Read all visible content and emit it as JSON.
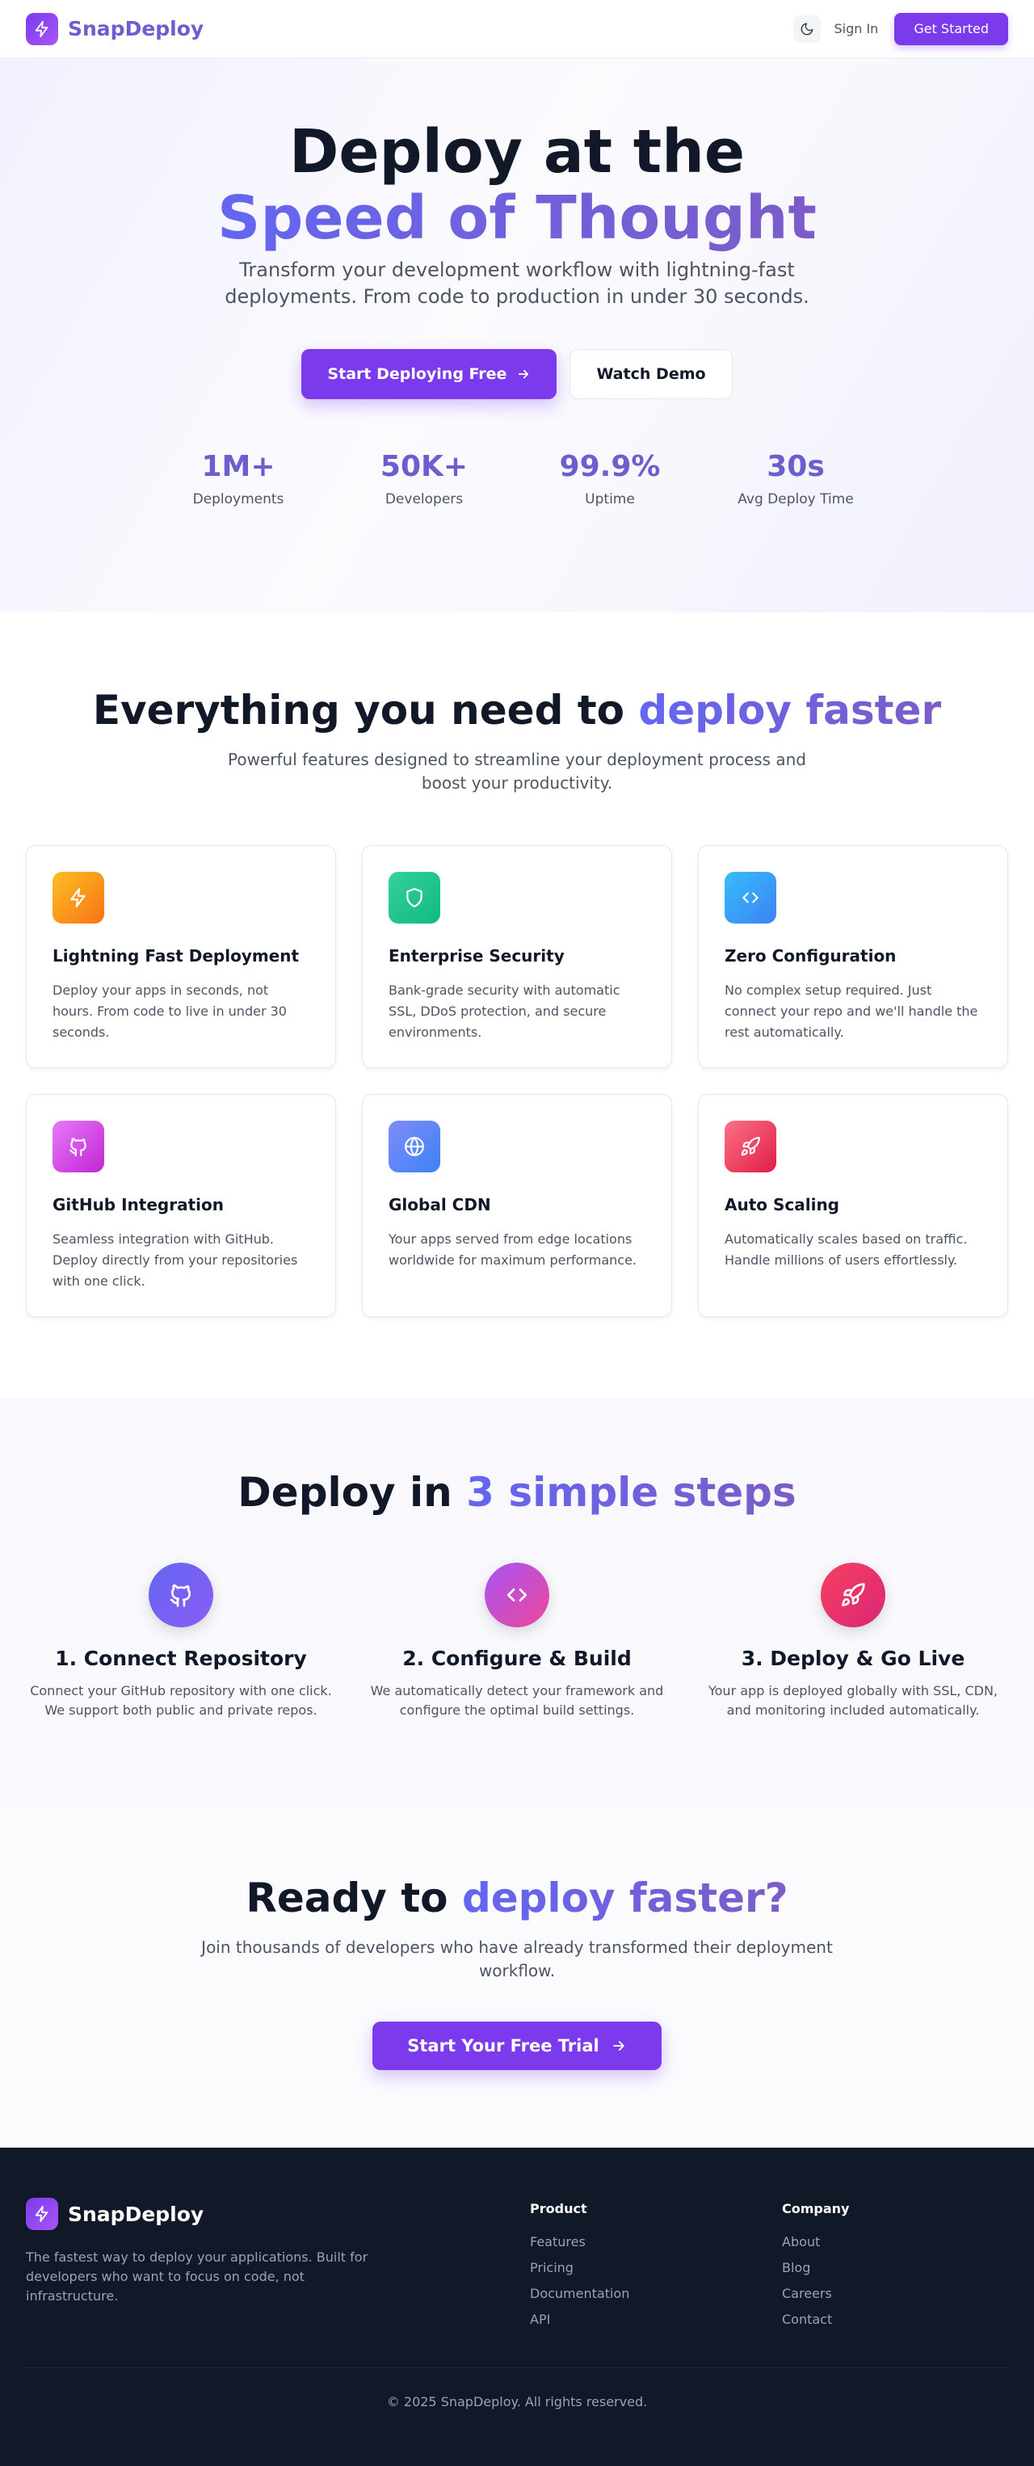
{
  "nav": {
    "brand": "SnapDeploy",
    "sign_in": "Sign In",
    "get_started": "Get Started"
  },
  "hero": {
    "title_line1": "Deploy at the",
    "title_line2": "Speed of Thought",
    "subtitle": "Transform your development workflow with lightning-fast deployments. From code to production in under 30 seconds.",
    "primary_cta": "Start Deploying Free",
    "secondary_cta": "Watch Demo",
    "stats": [
      {
        "value": "1M+",
        "label": "Deployments"
      },
      {
        "value": "50K+",
        "label": "Developers"
      },
      {
        "value": "99.9%",
        "label": "Uptime"
      },
      {
        "value": "30s",
        "label": "Avg Deploy Time"
      }
    ]
  },
  "features": {
    "title_plain": "Everything you need to ",
    "title_accent": "deploy faster",
    "subtitle": "Powerful features designed to streamline your deployment process and boost your productivity.",
    "cards": [
      {
        "icon": "lightning-icon",
        "title": "Lightning Fast Deployment",
        "desc": "Deploy your apps in seconds, not hours. From code to live in under 30 seconds."
      },
      {
        "icon": "shield-icon",
        "title": "Enterprise Security",
        "desc": "Bank-grade security with automatic SSL, DDoS protection, and secure environments."
      },
      {
        "icon": "code-icon",
        "title": "Zero Configuration",
        "desc": "No complex setup required. Just connect your repo and we'll handle the rest automatically."
      },
      {
        "icon": "github-icon",
        "title": "GitHub Integration",
        "desc": "Seamless integration with GitHub. Deploy directly from your repositories with one click."
      },
      {
        "icon": "globe-icon",
        "title": "Global CDN",
        "desc": "Your apps served from edge locations worldwide for maximum performance."
      },
      {
        "icon": "rocket-icon",
        "title": "Auto Scaling",
        "desc": "Automatically scales based on traffic. Handle millions of users effortlessly."
      }
    ]
  },
  "steps": {
    "title_plain": "Deploy in ",
    "title_accent": "3 simple steps",
    "items": [
      {
        "icon": "github-icon",
        "title": "1. Connect Repository",
        "desc": "Connect your GitHub repository with one click. We support both public and private repos."
      },
      {
        "icon": "code-icon",
        "title": "2. Configure & Build",
        "desc": "We automatically detect your framework and configure the optimal build settings."
      },
      {
        "icon": "rocket-icon",
        "title": "3. Deploy & Go Live",
        "desc": "Your app is deployed globally with SSL, CDN, and monitoring included automatically."
      }
    ]
  },
  "cta": {
    "title_plain": "Ready to ",
    "title_accent": "deploy faster?",
    "subtitle": "Join thousands of developers who have already transformed their deployment workflow.",
    "button": "Start Your Free Trial"
  },
  "footer": {
    "brand": "SnapDeploy",
    "description": "The fastest way to deploy your applications. Built for developers who want to focus on code, not infrastructure.",
    "columns": [
      {
        "title": "Product",
        "links": [
          "Features",
          "Pricing",
          "Documentation",
          "API"
        ]
      },
      {
        "title": "Company",
        "links": [
          "About",
          "Blog",
          "Careers",
          "Contact"
        ]
      }
    ],
    "copyright": "© 2025 SnapDeploy. All rights reserved."
  },
  "colors": {
    "brand_purple": "#7c3aed",
    "accent_indigo": "#6b5fcf",
    "footer_bg": "#111827"
  }
}
